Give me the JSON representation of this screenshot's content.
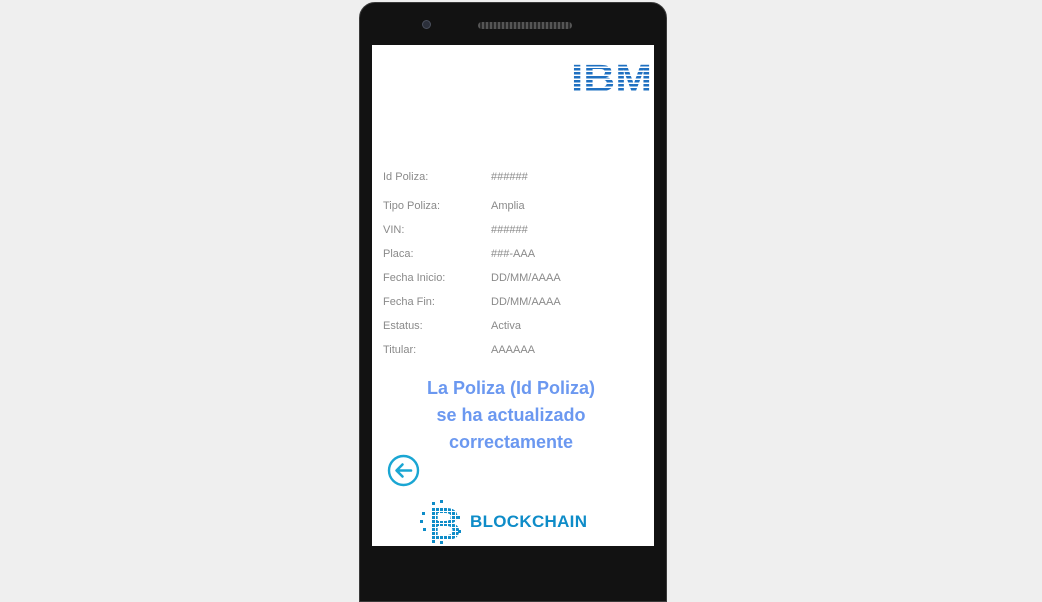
{
  "brand": {
    "top_logo": "IBM",
    "bottom_logo": "BLOCKCHAIN",
    "ibm_color": "#1f70c1",
    "blockchain_color": "#0e8cc8"
  },
  "policy": {
    "rows": [
      {
        "label": "Id Poliza:",
        "value": "######"
      },
      {
        "label": "Tipo Poliza:",
        "value": "Amplia"
      },
      {
        "label": "VIN:",
        "value": "######"
      },
      {
        "label": "Placa:",
        "value": "###-AAA"
      },
      {
        "label": "Fecha Inicio:",
        "value": "DD/MM/AAAA"
      },
      {
        "label": "Fecha Fin:",
        "value": "DD/MM/AAAA"
      },
      {
        "label": "Estatus:",
        "value": "Activa"
      },
      {
        "label": "Titular:",
        "value": "AAAAAA"
      }
    ]
  },
  "message": {
    "line1": "La Poliza (Id Poliza)",
    "line2": "se ha actualizado",
    "line3": "correctamente",
    "color": "#6b98f0"
  },
  "actions": {
    "back_icon": "arrow-left-circle-icon",
    "accent": "#1aa6d3"
  }
}
